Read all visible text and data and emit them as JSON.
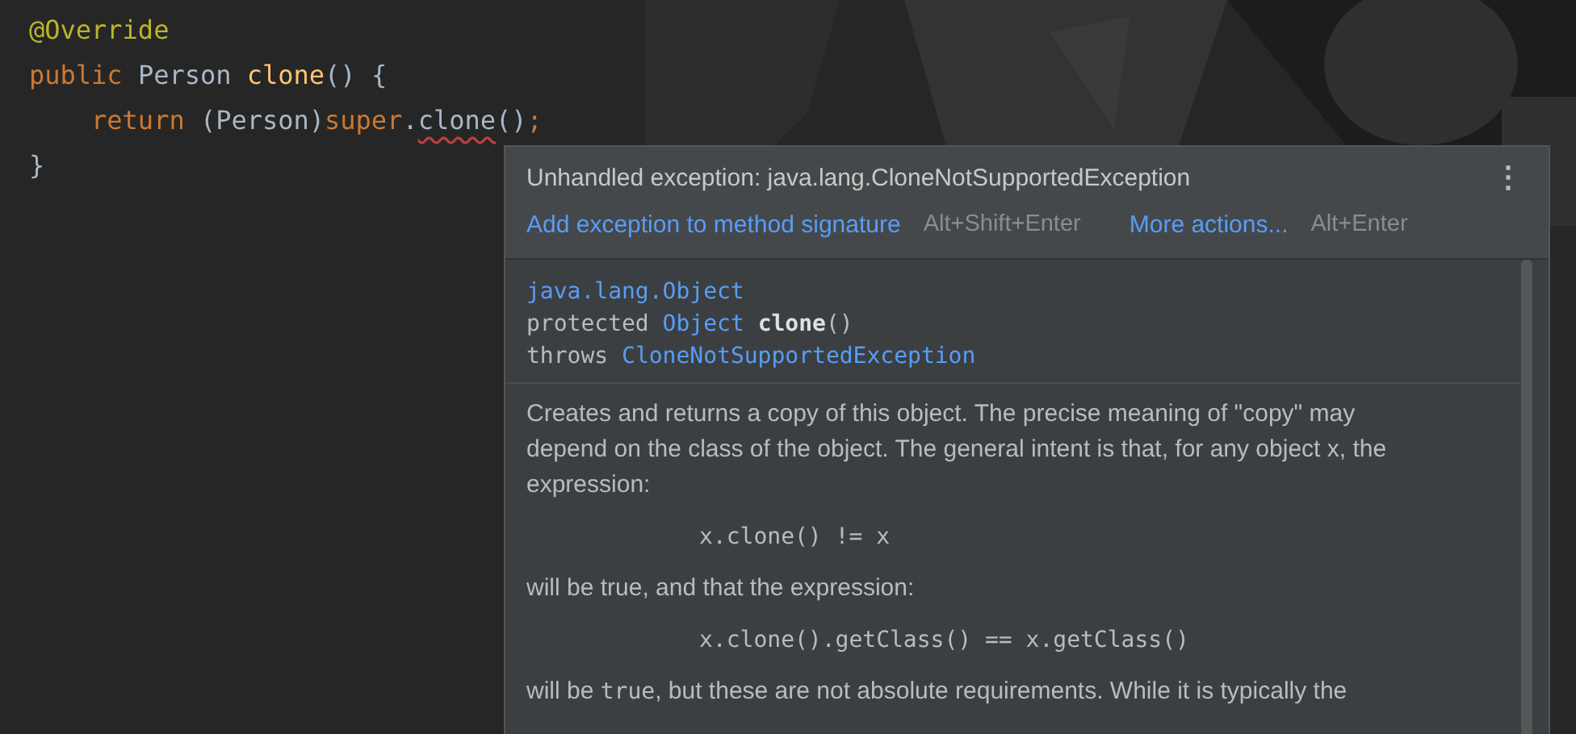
{
  "editor": {
    "lines": [
      [
        {
          "kind": "annotation",
          "text": "@Override"
        }
      ],
      [
        {
          "kind": "keyword",
          "text": "public "
        },
        {
          "kind": "plain",
          "text": "Person "
        },
        {
          "kind": "method",
          "text": "clone"
        },
        {
          "kind": "plain",
          "text": "() {"
        }
      ],
      [
        {
          "kind": "keyword",
          "text": "return ",
          "indent": true
        },
        {
          "kind": "plain",
          "text": "(Person)"
        },
        {
          "kind": "keyword",
          "text": "super"
        },
        {
          "kind": "plain",
          "text": "."
        },
        {
          "kind": "error",
          "text": "clone"
        },
        {
          "kind": "plain",
          "text": "()"
        },
        {
          "kind": "keyword",
          "text": ";"
        }
      ],
      [
        {
          "kind": "plain",
          "text": "}"
        }
      ]
    ]
  },
  "popup": {
    "title": "Unhandled exception: java.lang.CloneNotSupportedException",
    "menu_icon": "⋮",
    "actions": [
      {
        "label": "Add exception to method signature",
        "shortcut": "Alt+Shift+Enter"
      },
      {
        "label": "More actions...",
        "shortcut": "Alt+Enter"
      }
    ],
    "signature": [
      [
        {
          "kind": "link",
          "text": "java.lang.Object"
        }
      ],
      [
        {
          "kind": "plain",
          "text": "protected "
        },
        {
          "kind": "link",
          "text": "Object "
        },
        {
          "kind": "bold",
          "text": "clone"
        },
        {
          "kind": "plain",
          "text": "()"
        }
      ],
      [
        {
          "kind": "plain",
          "text": "throws "
        },
        {
          "kind": "link",
          "text": "CloneNotSupportedException"
        }
      ]
    ],
    "doc": [
      {
        "kind": "text",
        "parts": [
          {
            "kind": "text",
            "text": "Creates and returns a copy of this object. The precise meaning of \"copy\" may depend on the class of the object. The general intent is that, for any object x, the expression:"
          }
        ]
      },
      {
        "kind": "code",
        "parts": [
          {
            "kind": "text",
            "text": "x.clone() != x"
          }
        ]
      },
      {
        "kind": "text",
        "parts": [
          {
            "kind": "text",
            "text": "will be true, and that the expression:"
          }
        ]
      },
      {
        "kind": "code",
        "parts": [
          {
            "kind": "text",
            "text": "x.clone().getClass() == x.getClass()"
          }
        ]
      },
      {
        "kind": "text",
        "parts": [
          {
            "kind": "text",
            "text": "will be "
          },
          {
            "kind": "code",
            "text": "true"
          },
          {
            "kind": "text",
            "text": ", but these are not absolute requirements. While it is typically the"
          }
        ]
      }
    ]
  }
}
